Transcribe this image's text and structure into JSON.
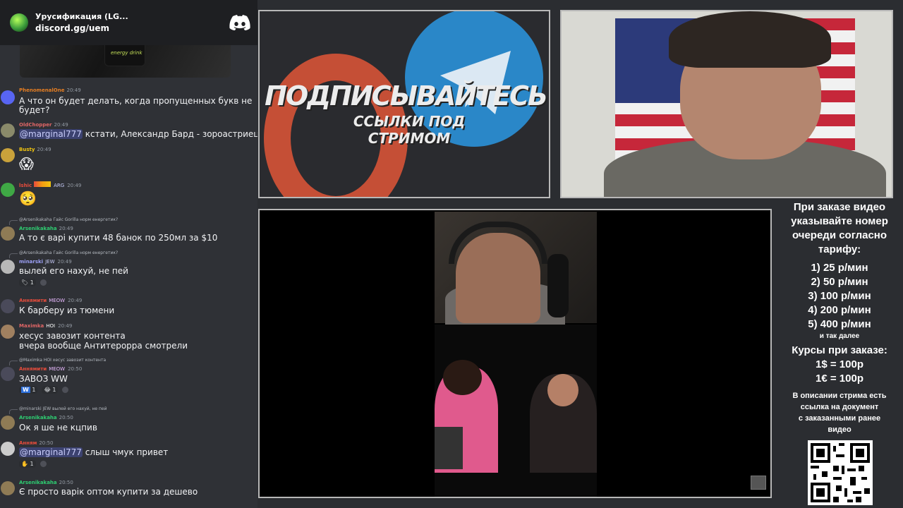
{
  "server": {
    "name": "Урусификация (LG...",
    "link": "discord.gg/uem"
  },
  "embed": {
    "can_text": "energy drink"
  },
  "messages": [
    {
      "author": "PhenomenalOne",
      "time": "20:49",
      "text": "А что он будет делать, когда пропущенных букв не",
      "text2": "будет?"
    },
    {
      "author": "OldChopper",
      "time": "20:49",
      "mention": "@marginal777",
      "text": " кстати, Александр Бард - зороастриец"
    },
    {
      "author": "Busty",
      "time": "20:49",
      "text": "😱"
    },
    {
      "author": "lshic",
      "badge": "ARG",
      "time": "20:49",
      "text": "🥺"
    },
    {
      "reply": "@Arsenikakaha Гайс Gorilla норм енергетик?",
      "author": "Arsenikakaha",
      "time": "20:49",
      "text": "А то є варі купити 48 банок по 250мл за $10"
    },
    {
      "reply": "@Arsenikakaha Гайс Gorilla норм енергетик?",
      "author": "minarski",
      "badge": "JEW",
      "time": "20:49",
      "text": "вылей его нахуй, не пей",
      "react": "1"
    },
    {
      "author": "Аннямити",
      "badge": "MEOW",
      "time": "20:49",
      "text": "К барберу из тюмени"
    },
    {
      "author": "Maximka",
      "badge": "HOI",
      "time": "20:49",
      "text": "хесус завозит контента",
      "text2": "вчера вообще Антитерорра смотрели"
    },
    {
      "reply": "@Maximka HOI хесус завозит контента",
      "author": "Аннямити",
      "badge": "MEOW",
      "time": "20:50",
      "text": "ЗАВОЗ WW",
      "react": "1",
      "react2": "1"
    },
    {
      "reply": "@minarski JEW вылей его нахуй, не пей",
      "author": "Arsenikakaha",
      "time": "20:50",
      "text": "Ок я ше не кцпив"
    },
    {
      "author": "Анням",
      "time": "20:50",
      "mention": "@marginal777",
      "text": " слыш чмук привет",
      "react": "1"
    },
    {
      "author": "Arsenikakaha",
      "time": "20:50",
      "text": "Є просто варік  оптом купити за дешево"
    }
  ],
  "promo": {
    "line1": "ПОДПИСЫВАЙТЕСЬ",
    "line2": "ССЫЛКИ ПОД СТРИМОМ"
  },
  "info": {
    "l1": "При заказе видео",
    "l2": "указывайте номер",
    "l3": "очереди согласно",
    "l4": "тарифу:",
    "t1": "1) 25 р/мин",
    "t2": "2) 50 р/мин",
    "t3": "3) 100 р/мин",
    "t4": "4) 200 р/мин",
    "t5": "5) 400 р/мин",
    "t6": "и так далее",
    "c1": "Курсы при заказе:",
    "c2": "1$ = 100р",
    "c3": "1€ = 100р",
    "d1": "В описании стрима есть",
    "d2": "ссылка на документ",
    "d3": "с заказанными ранее",
    "d4": "видео"
  }
}
